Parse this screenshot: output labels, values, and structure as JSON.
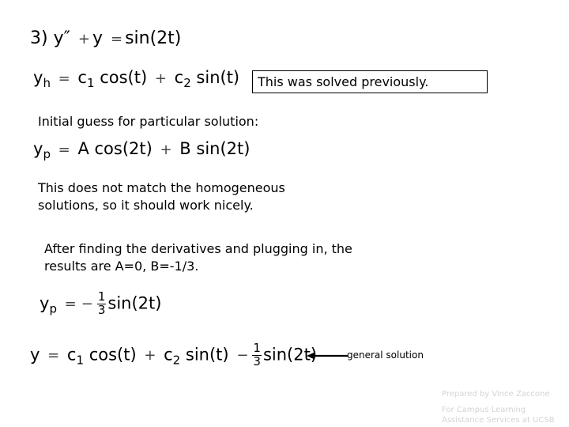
{
  "problem": {
    "number": "3)",
    "lhs_y": "y",
    "lhs_prime": "″",
    "plus": "+",
    "lhs_y2": "y",
    "equals": "=",
    "rhs": "sin(2t)"
  },
  "homogeneous": {
    "y": "y",
    "sub": "h",
    "equals": "=",
    "c1": "c",
    "c1_sub": "1",
    "term1": "cos(t)",
    "plus": "+",
    "c2": "c",
    "c2_sub": "2",
    "term2": "sin(t)"
  },
  "note_box": {
    "text": "This was solved previously."
  },
  "initial_guess_label": "Initial guess for particular solution:",
  "particular_guess": {
    "y": "y",
    "sub": "p",
    "equals": "=",
    "a": "A",
    "term1": "cos(2t)",
    "plus": "+",
    "b": "B",
    "term2": "sin(2t)"
  },
  "no_match_text": "This does not match the homogeneous solutions, so it should work nicely.",
  "after_finding_text": "After finding the derivatives and plugging in, the results are A=0, B=-1/3.",
  "particular_result": {
    "y": "y",
    "sub": "p",
    "equals": "=",
    "minus": "−",
    "num": "1",
    "den": "3",
    "term": "sin(2t)"
  },
  "general_solution": {
    "y": "y",
    "equals": "=",
    "c1": "c",
    "c1_sub": "1",
    "term1": "cos(t)",
    "plus": "+",
    "c2": "c",
    "c2_sub": "2",
    "term2": "sin(t)",
    "minus": "−",
    "num": "1",
    "den": "3",
    "term3": "sin(2t)"
  },
  "arrow": {
    "icon": "arrow-left-icon",
    "label": "general solution"
  },
  "credits": {
    "line1": "Prepared by Vince Zaccone",
    "line2": "For Campus Learning",
    "line3": "Assistance Services at UCSB"
  }
}
